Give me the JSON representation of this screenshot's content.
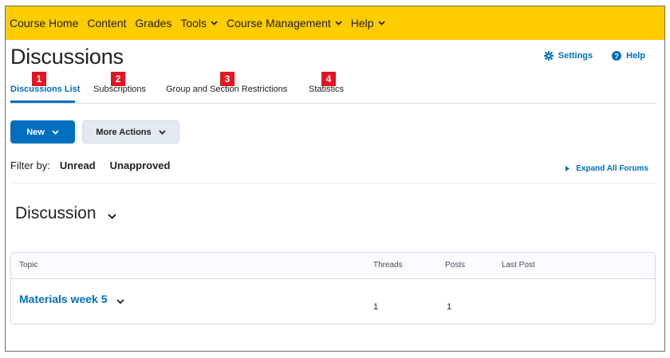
{
  "nav": {
    "items": [
      {
        "label": "Course Home",
        "dropdown": false
      },
      {
        "label": "Content",
        "dropdown": false
      },
      {
        "label": "Grades",
        "dropdown": false
      },
      {
        "label": "Tools",
        "dropdown": true
      },
      {
        "label": "Course Management",
        "dropdown": true
      },
      {
        "label": "Help",
        "dropdown": true
      }
    ],
    "background": "#ffcc00"
  },
  "page": {
    "title": "Discussions",
    "settings_label": "Settings",
    "help_label": "Help"
  },
  "tabs": [
    {
      "label": "Discussions List",
      "badge": "1",
      "active": true
    },
    {
      "label": "Subscriptions",
      "badge": "2",
      "active": false
    },
    {
      "label": "Group and Section Restrictions",
      "badge": "3",
      "active": false
    },
    {
      "label": "Statistics",
      "badge": "4",
      "active": false
    }
  ],
  "actions": {
    "new_label": "New",
    "more_label": "More Actions"
  },
  "filter": {
    "label": "Filter by:",
    "options": [
      "Unread",
      "Unapproved"
    ],
    "expand_all_label": "Expand All Forums"
  },
  "forum": {
    "title": "Discussion",
    "columns": {
      "topic": "Topic",
      "threads": "Threads",
      "posts": "Posts",
      "last_post": "Last Post"
    },
    "rows": [
      {
        "topic": "Materials week 5",
        "threads": "1",
        "posts": "1",
        "last_post": ""
      }
    ]
  },
  "colors": {
    "accent": "#006fbf",
    "badge": "#e4151f",
    "navbar": "#ffcc00"
  },
  "icons": {
    "settings": "gear-icon",
    "help": "help-circle-icon",
    "expand": "triangle-right-icon",
    "dropdown": "chevron-down-icon"
  }
}
